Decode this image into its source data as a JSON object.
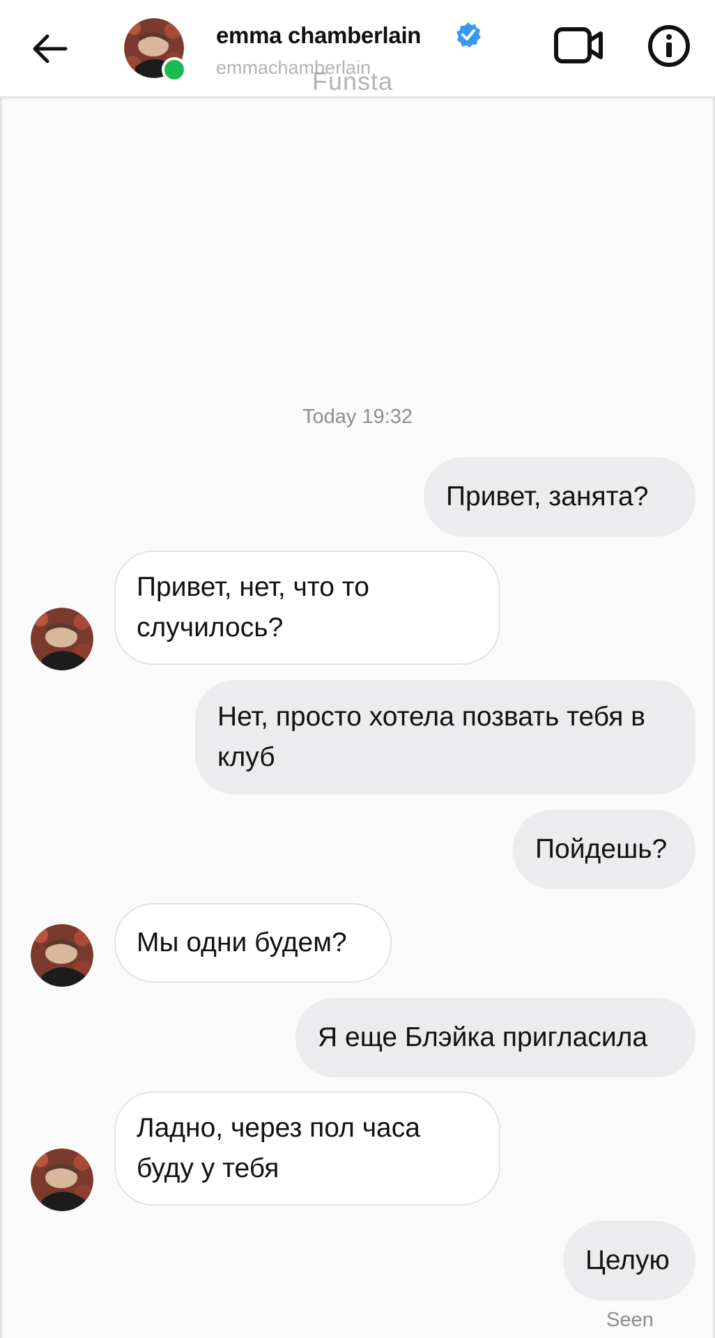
{
  "header": {
    "name": "emma chamberlain",
    "username": "emmachamberlain",
    "overlay_text": "Funsta",
    "verified": true,
    "online": true,
    "icons": {
      "back": "back-arrow-icon",
      "video": "video-camera-icon",
      "info": "info-icon",
      "verified": "verified-badge-icon"
    }
  },
  "thread": {
    "timestamp": "Today 19:32",
    "messages": [
      {
        "side": "out",
        "text": "Привет, занята?"
      },
      {
        "side": "in",
        "text": "Привет, нет, что то случилось?"
      },
      {
        "side": "out",
        "text": "Нет, просто хотела позвать тебя в клуб"
      },
      {
        "side": "out",
        "text": "Пойдешь?"
      },
      {
        "side": "in",
        "text": "Мы одни будем?"
      },
      {
        "side": "out",
        "text": "Я еще Блэйка пригласила"
      },
      {
        "side": "in",
        "text": "Ладно, через пол часа буду у тебя"
      },
      {
        "side": "out",
        "text": "Целую"
      }
    ],
    "seen_label": "Seen"
  },
  "colors": {
    "accent_verified": "#3897f0",
    "online": "#1db954",
    "outgoing_bubble": "#ececef",
    "incoming_bubble": "#ffffff",
    "meta_text": "#8e8e8e"
  }
}
